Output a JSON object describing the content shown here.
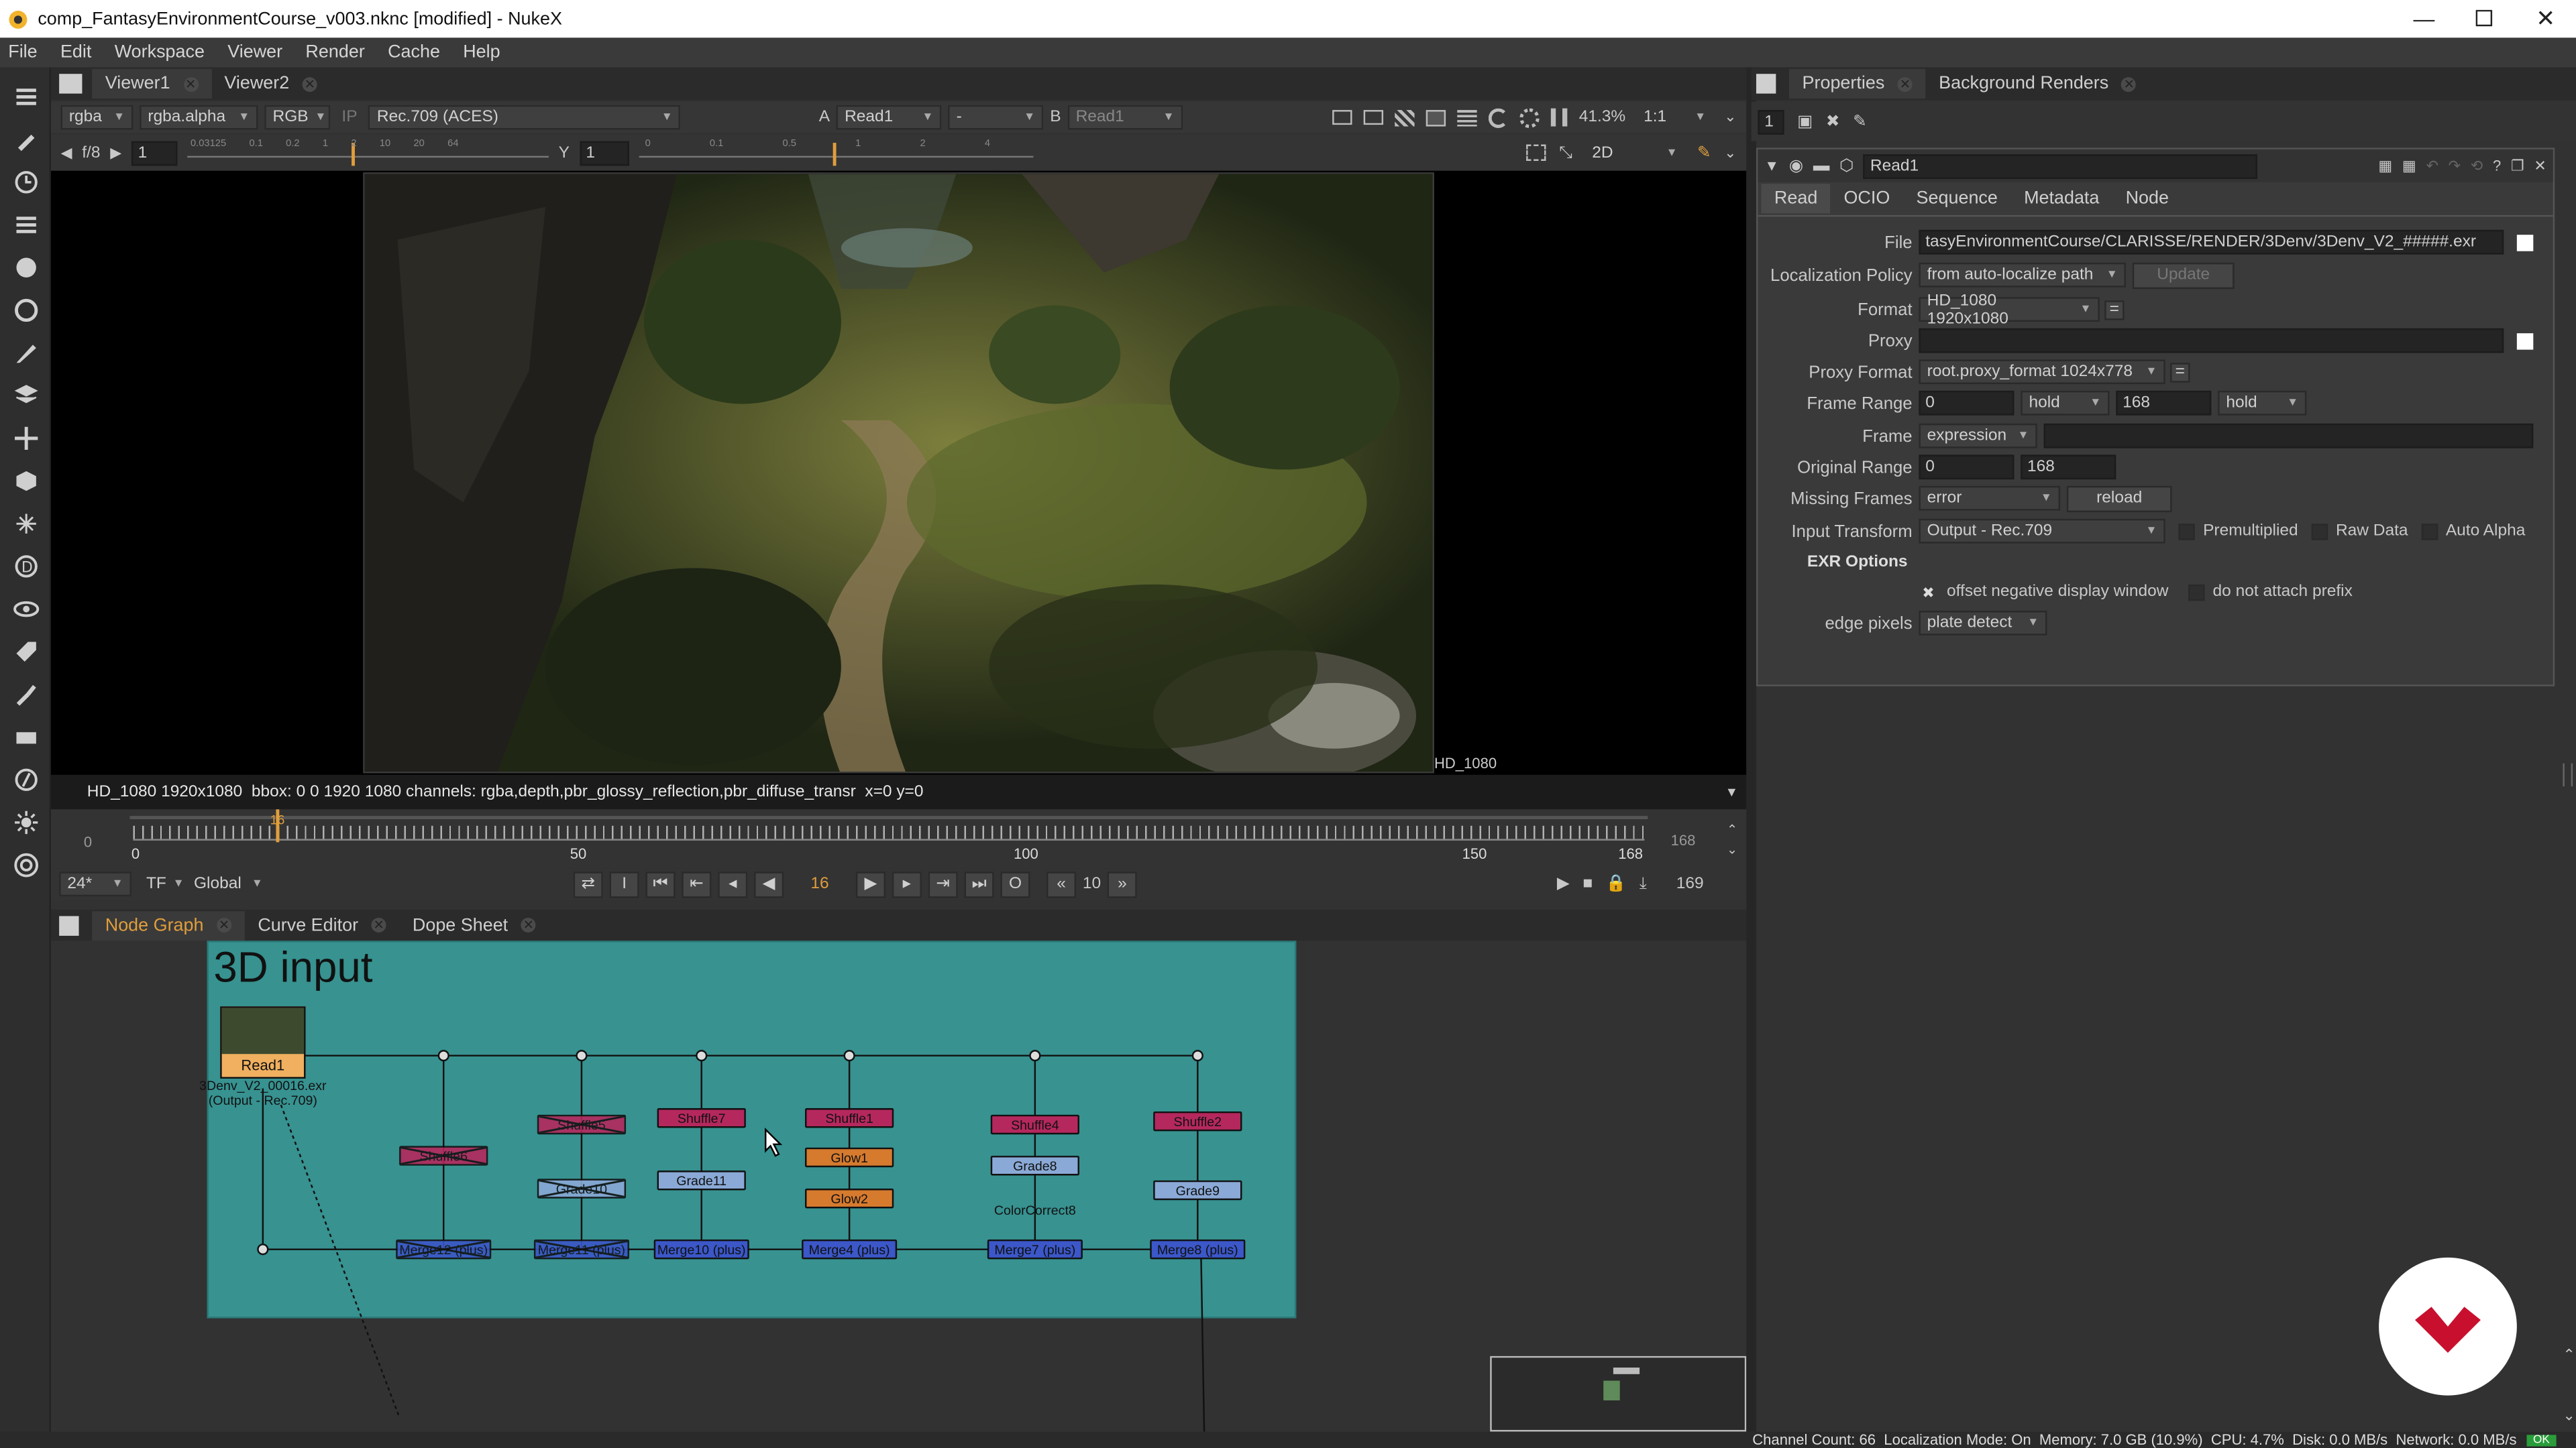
{
  "window": {
    "title": "comp_FantasyEnvironmentCourse_v003.nknc [modified] - NukeX",
    "controls": [
      "minimize",
      "maximize",
      "close"
    ]
  },
  "menu": [
    "File",
    "Edit",
    "Workspace",
    "Viewer",
    "Render",
    "Cache",
    "Help"
  ],
  "viewer": {
    "tabs": [
      "Viewer1",
      "Viewer2"
    ],
    "channels": "rgba",
    "alpha": "rgba.alpha",
    "color": "RGB",
    "ip_label": "IP",
    "colorspace": "Rec.709 (ACES)",
    "a_label": "A",
    "a_input": "Read1",
    "a_op": "-",
    "b_label": "B",
    "b_input": "Read1",
    "zoom": "41.3%",
    "ratio": "1:1",
    "fstop": "f/8",
    "gain": "1",
    "y_label": "Y",
    "gamma": "1",
    "view_mode": "2D",
    "format_label": "HD_1080",
    "info_line": "HD_1080 1920x1080  bbox: 0 0 1920 1080 channels: rgba,depth,pbr_glossy_reflection,pbr_diffuse_transr  x=0 y=0",
    "gain_ticks": [
      "0.03125",
      "0.1",
      "0.2",
      "1",
      "2",
      "10",
      "20",
      "64"
    ],
    "gamma_ticks": [
      "0",
      "0.1",
      "0.5",
      "1",
      "2",
      "4"
    ]
  },
  "timeline": {
    "start": "0",
    "end": "168",
    "current": "16",
    "labels": [
      "0",
      "50",
      "100",
      "150",
      "168"
    ],
    "end_box": "168",
    "fps": "24*",
    "tf": "TF",
    "scope": "Global",
    "frame_display": "16",
    "step": "10",
    "out_frame": "169",
    "current_fraction": 0.095
  },
  "lower_tabs": [
    "Node Graph",
    "Curve Editor",
    "Dope Sheet"
  ],
  "backdrop": {
    "label": "3D input",
    "color": "#379290"
  },
  "read_node": {
    "name": "Read1",
    "file": "3Denv_V2_00016.exr",
    "transform": "(Output - Rec.709)"
  },
  "nodes": [
    {
      "name": "Shuffle6",
      "type": "shuffle",
      "disabled": true
    },
    {
      "name": "Shuffle5",
      "type": "shuffle",
      "disabled": true
    },
    {
      "name": "Grade10",
      "type": "grade",
      "disabled": true
    },
    {
      "name": "Shuffle7",
      "type": "shuffle"
    },
    {
      "name": "Grade11",
      "type": "grade"
    },
    {
      "name": "Shuffle1",
      "type": "shuffle"
    },
    {
      "name": "Glow1",
      "type": "glow"
    },
    {
      "name": "Glow2",
      "type": "glow"
    },
    {
      "name": "Shuffle4",
      "type": "shuffle"
    },
    {
      "name": "Grade8",
      "type": "grade"
    },
    {
      "name": "ColorCorrect8",
      "type": "cc"
    },
    {
      "name": "Shuffle2",
      "type": "shuffle"
    },
    {
      "name": "Grade9",
      "type": "grade"
    },
    {
      "name": "Merge12 (plus)",
      "type": "merge",
      "disabled": true
    },
    {
      "name": "Merge11 (plus)",
      "type": "merge",
      "disabled": true
    },
    {
      "name": "Merge10 (plus)",
      "type": "merge"
    },
    {
      "name": "Merge4 (plus)",
      "type": "merge"
    },
    {
      "name": "Merge7 (plus)",
      "type": "merge"
    },
    {
      "name": "Merge8 (plus)",
      "type": "merge"
    }
  ],
  "properties": {
    "tabs": [
      "Properties",
      "Background Renders"
    ],
    "max_panels": "1",
    "node_name": "Read1",
    "sub_tabs": [
      "Read",
      "OCIO",
      "Sequence",
      "Metadata",
      "Node"
    ],
    "file_label": "File",
    "file_value": "tasyEnvironmentCourse/CLARISSE/RENDER/3Denv/3Denv_V2_#####.exr",
    "localization_label": "Localization Policy",
    "localization_value": "from auto-localize path",
    "update_label": "Update",
    "format_label": "Format",
    "format_value": "HD_1080 1920x1080",
    "proxy_label": "Proxy",
    "proxy_value": "",
    "proxy_format_label": "Proxy Format",
    "proxy_format_value": "root.proxy_format 1024x778",
    "frame_range_label": "Frame Range",
    "frame_range_start": "0",
    "frame_range_before": "hold",
    "frame_range_end": "168",
    "frame_range_after": "hold",
    "frame_label": "Frame",
    "frame_mode": "expression",
    "frame_value": "",
    "original_range_label": "Original Range",
    "original_start": "0",
    "original_end": "168",
    "missing_frames_label": "Missing Frames",
    "missing_frames_value": "error",
    "reload_label": "reload",
    "input_transform_label": "Input Transform",
    "input_transform_value": "Output - Rec.709",
    "premultiplied_label": "Premultiplied",
    "raw_data_label": "Raw Data",
    "auto_alpha_label": "Auto Alpha",
    "exr_options_label": "EXR Options",
    "offset_label": "offset negative display window",
    "no_prefix_label": "do not attach prefix",
    "edge_pixels_label": "edge pixels",
    "edge_pixels_value": "plate detect"
  },
  "status_bar": "Channel Count: 66  Localization Mode: On  Memory: 7.0 GB (10.9%)  CPU: 4.7%  Disk: 0.0 MB/s  Network: 0.0 MB/s",
  "status_ok": "OK",
  "colors": {
    "shuffle": "#b5285e",
    "grade": "#8aa9d6",
    "glow": "#d67a2e",
    "merge": "#3b57c8",
    "read": "#f0b060",
    "brand": "#c8102e"
  }
}
